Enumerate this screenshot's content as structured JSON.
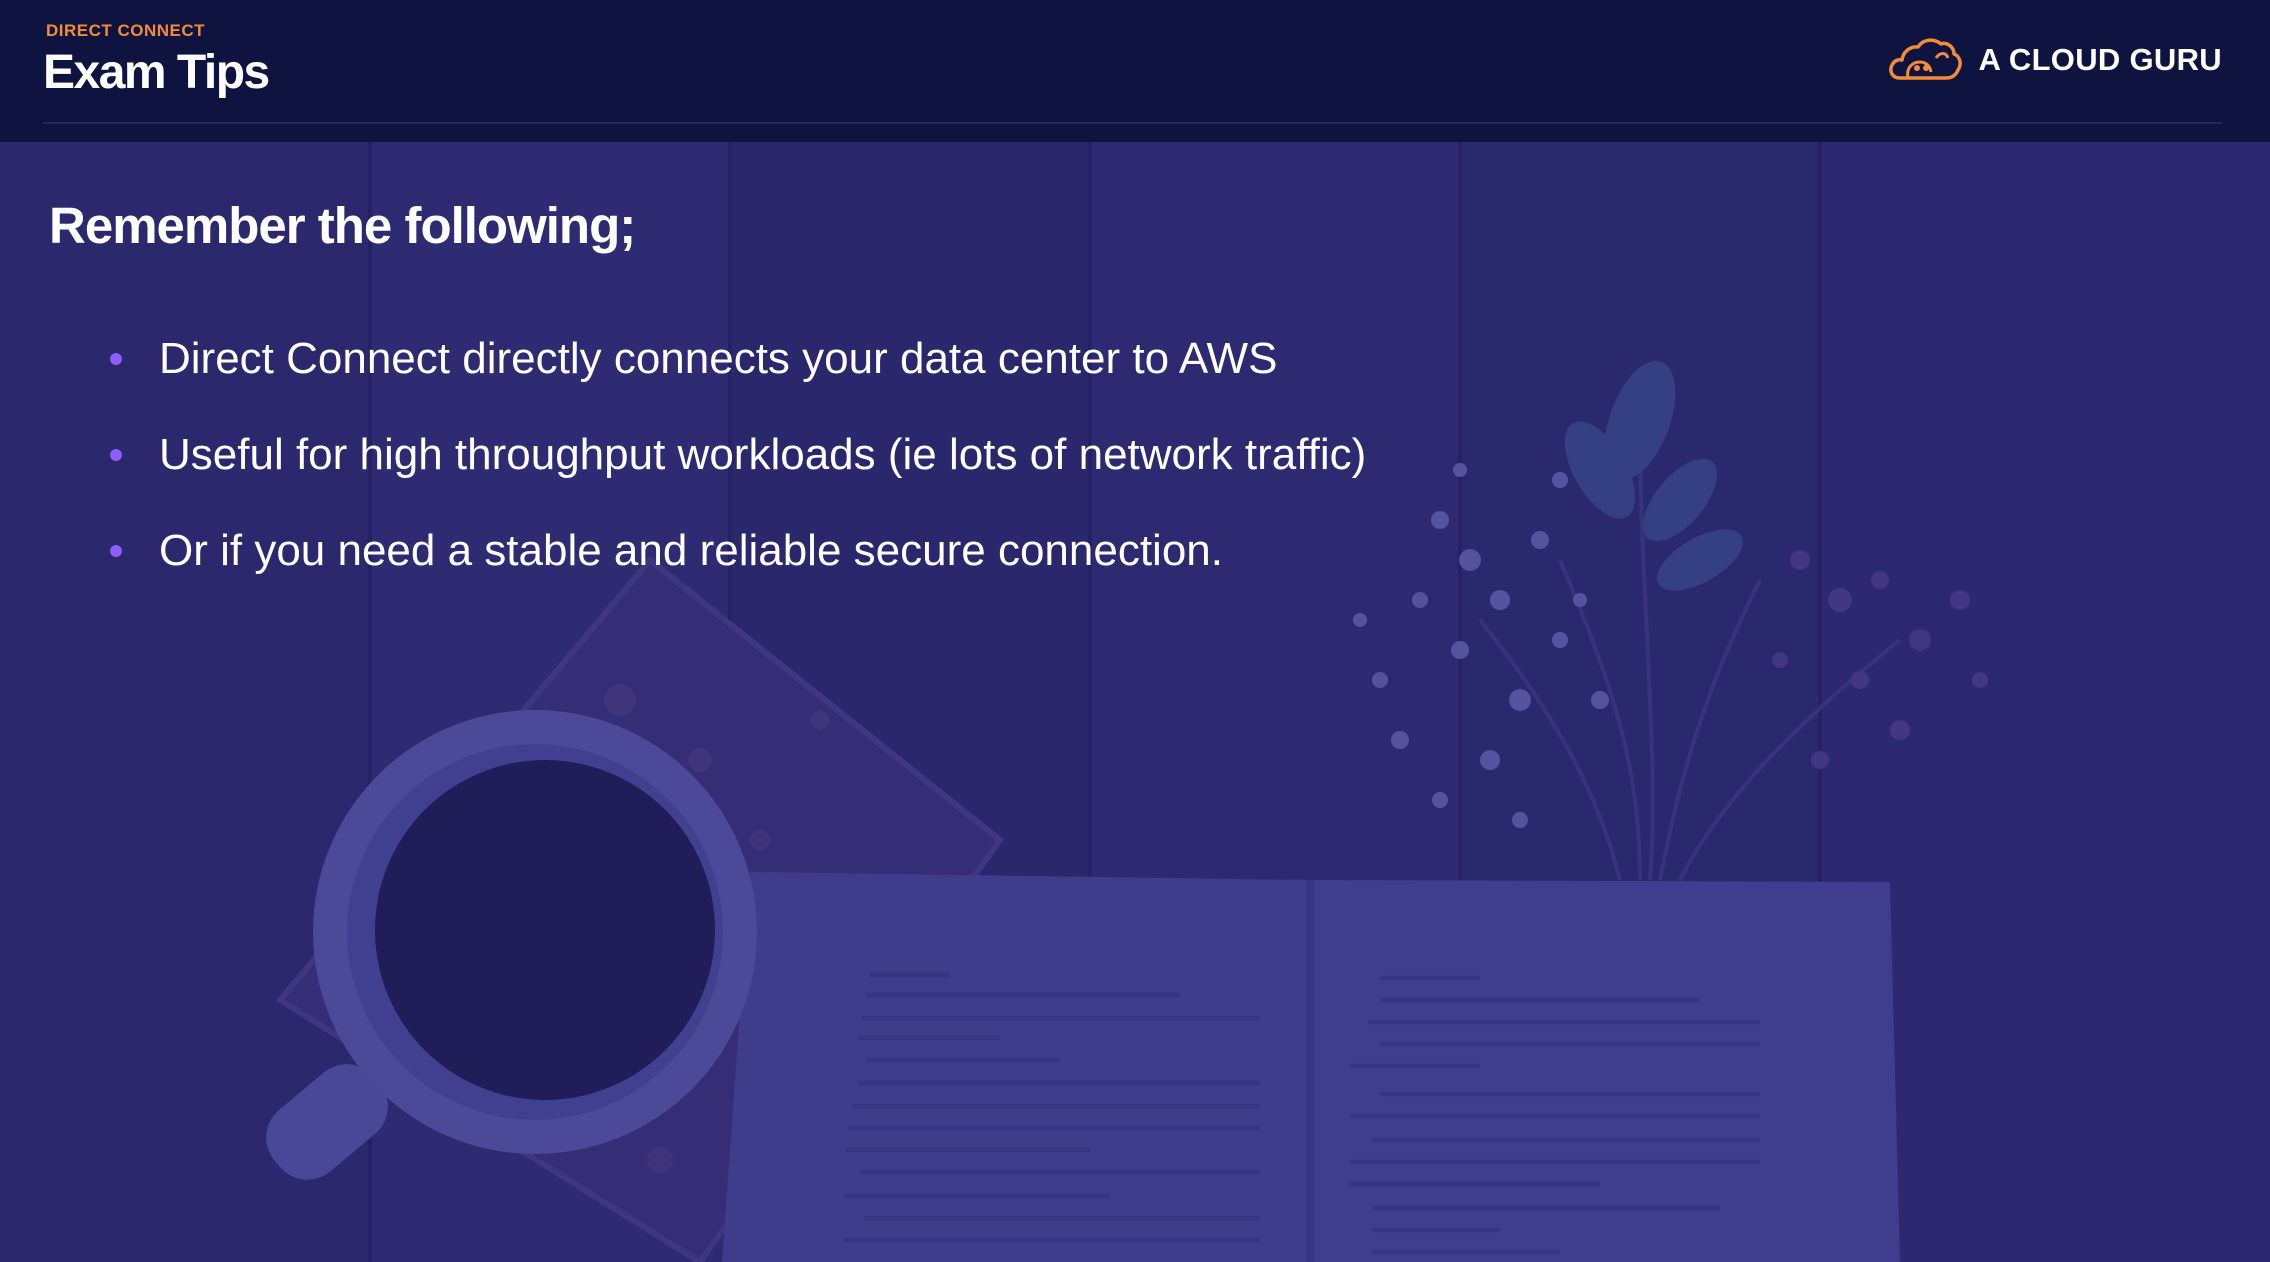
{
  "header": {
    "eyebrow": "DIRECT CONNECT",
    "title": "Exam Tips",
    "brand": {
      "name": "A CLOUD GURU",
      "logo_icon": "cloud-guru-logo-icon"
    }
  },
  "content": {
    "heading": "Remember the following;",
    "bullets": [
      "Direct Connect directly connects your data center to AWS",
      "Useful for high throughput workloads (ie lots of network traffic)",
      "Or if you need a stable and reliable secure connection."
    ]
  },
  "colors": {
    "header_bg": "#0f1340",
    "overlay": "#2b2668",
    "eyebrow": "#f28c38",
    "bullet": "#8f5cf5",
    "text": "#ffffff"
  }
}
